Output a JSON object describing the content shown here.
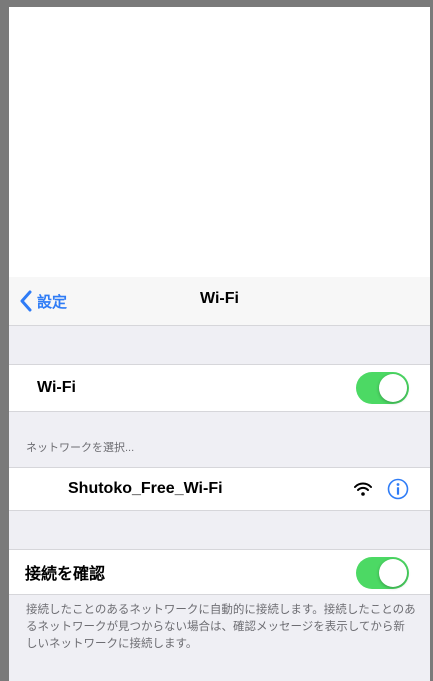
{
  "nav": {
    "back_label": "設定",
    "title": "Wi-Fi"
  },
  "wifi_row": {
    "label": "Wi-Fi",
    "enabled": true
  },
  "network_section": {
    "header": "ネットワークを選択...",
    "networks": [
      {
        "name": "Shutoko_Free_Wi-Fi",
        "icons": [
          "wifi-signal-icon",
          "info-icon"
        ]
      }
    ]
  },
  "ask_join": {
    "label": "接続を確認",
    "enabled": true,
    "footer": "接続したことのあるネットワークに自動的に接続します。接続したことのあるネットワークが見つからない場合は、確認メッセージを表示してから新しいネットワークに接続します。"
  },
  "colors": {
    "accent": "#2f7cf6",
    "toggle_on": "#4cd964",
    "group_background": "#efeff4"
  }
}
